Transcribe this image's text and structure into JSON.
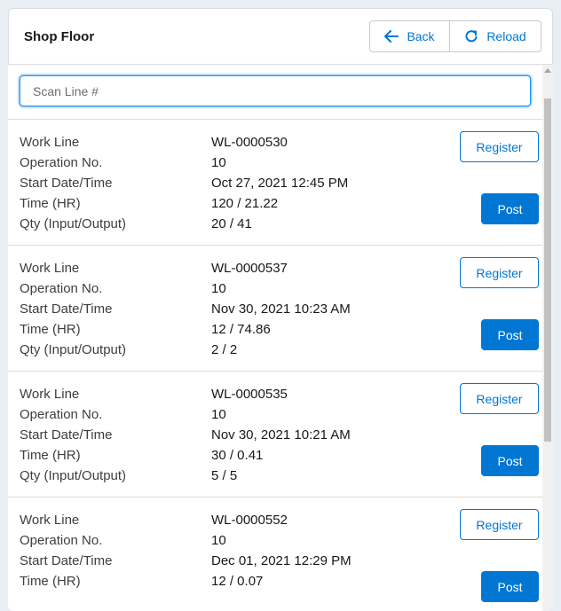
{
  "header": {
    "title": "Shop Floor",
    "back_label": "Back",
    "reload_label": "Reload"
  },
  "search": {
    "placeholder": "Scan Line #",
    "value": ""
  },
  "labels": {
    "work_line": "Work Line",
    "operation_no": "Operation No.",
    "start": "Start Date/Time",
    "time": "Time (HR)",
    "qty": "Qty (Input/Output)",
    "register": "Register",
    "post": "Post"
  },
  "items": [
    {
      "work_line": "WL-0000530",
      "operation_no": "10",
      "start": "Oct 27, 2021 12:45 PM",
      "time": "120 / 21.22",
      "qty": "20 / 41"
    },
    {
      "work_line": "WL-0000537",
      "operation_no": "10",
      "start": "Nov 30, 2021 10:23 AM",
      "time": "12 / 74.86",
      "qty": "2 / 2"
    },
    {
      "work_line": "WL-0000535",
      "operation_no": "10",
      "start": "Nov 30, 2021 10:21 AM",
      "time": "30 / 0.41",
      "qty": "5 / 5"
    },
    {
      "work_line": "WL-0000552",
      "operation_no": "10",
      "start": "Dec 01, 2021 12:29 PM",
      "time": "12 / 0.07",
      "qty": ""
    }
  ],
  "colors": {
    "brand": "#0176d3",
    "focus": "#1b96ff"
  }
}
